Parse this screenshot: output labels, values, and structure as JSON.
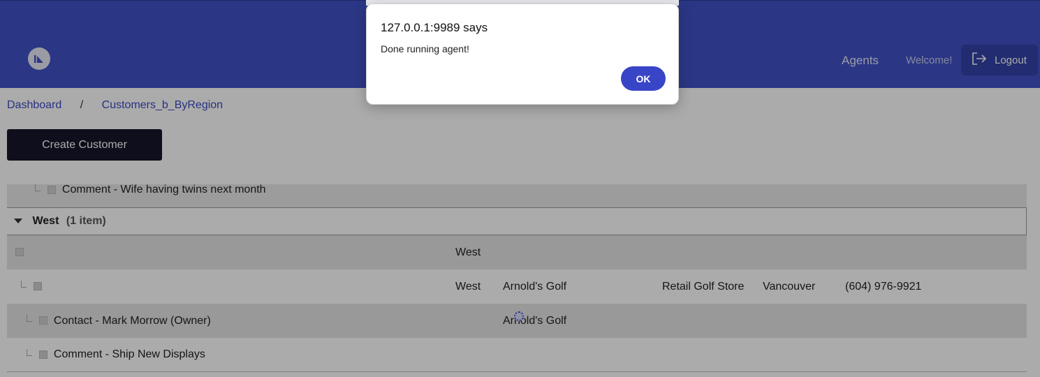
{
  "header": {
    "nav_agents": "Agents",
    "welcome": "Welcome!",
    "logout": "Logout"
  },
  "breadcrumb": {
    "dashboard": "Dashboard",
    "separator": "/",
    "current": "Customers_b_ByRegion"
  },
  "create_button": "Create Customer",
  "grid": {
    "partial_row": "Comment - Wife having twins next month",
    "group": {
      "name": "West",
      "count": "(1 item)"
    },
    "rows": [
      {
        "region": "West"
      },
      {
        "region": "West",
        "name": "Arnold's Golf",
        "type": "Retail Golf Store",
        "city": "Vancouver",
        "phone": "(604) 976-9921"
      },
      {
        "label": "Contact - Mark Morrow (Owner)",
        "name": "Arnold's Golf"
      },
      {
        "label": "Comment - Ship New Displays"
      }
    ]
  },
  "dialog": {
    "title": "127.0.0.1:9989 says",
    "message": "Done running agent!",
    "ok": "OK"
  },
  "colors": {
    "header_bg": "#4052c6",
    "accent": "#3845c7",
    "button_dark": "#15152a"
  }
}
